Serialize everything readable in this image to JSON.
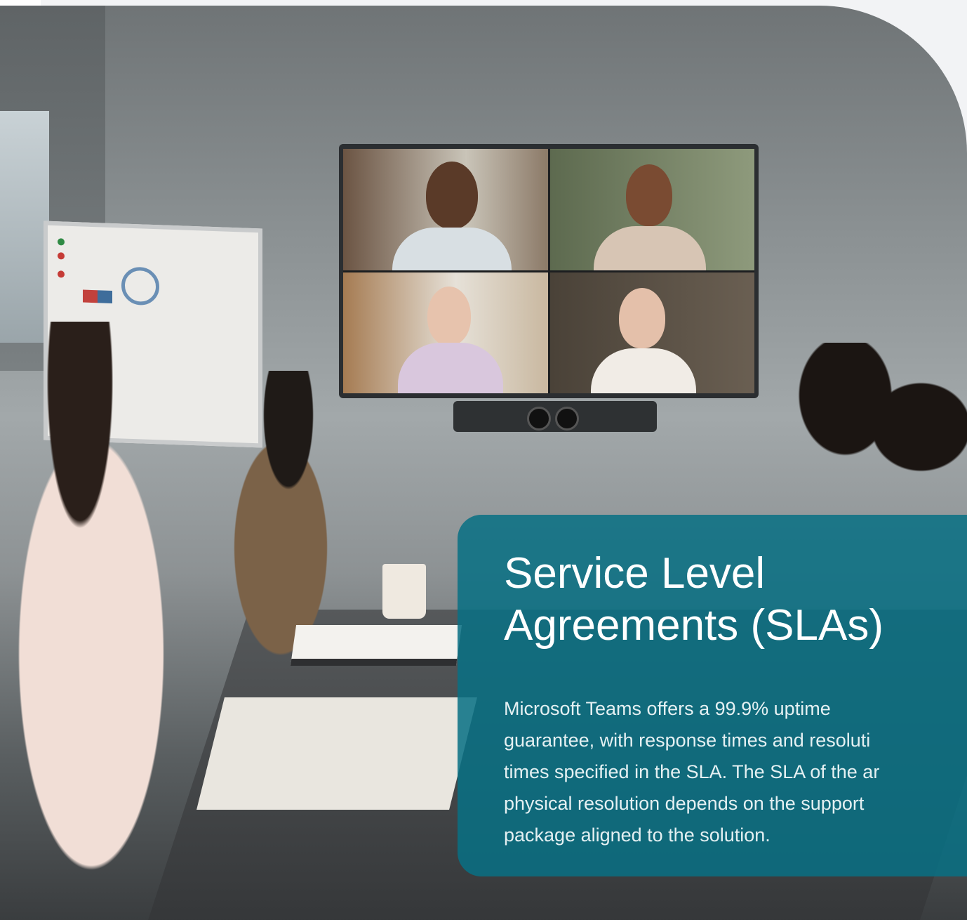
{
  "hero": {
    "image_alt": "Team applauding during a video conference meeting",
    "card": {
      "title_line1": "Service Level",
      "title_line2": "Agreements (SLAs)",
      "body_lines": [
        "Microsoft Teams offers a 99.9% uptime",
        "guarantee, with response times and resoluti",
        "times specified in the SLA. The SLA of the ar",
        "physical resolution depends on the support",
        "package aligned to the solution."
      ],
      "background_color": "#087084",
      "text_color": "#ffffff"
    }
  }
}
